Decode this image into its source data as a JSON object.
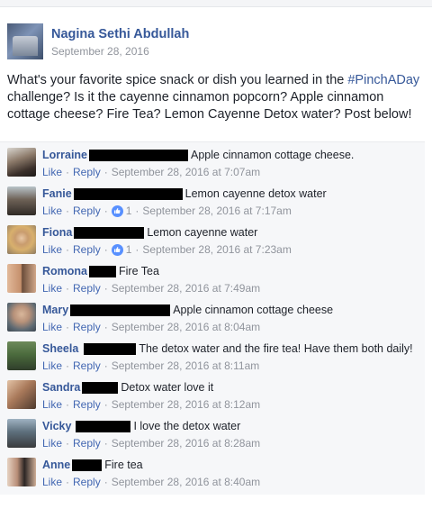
{
  "post": {
    "author": "Nagina Sethi Abdullah",
    "date": "September 28, 2016",
    "text_before": "What's your favorite spice snack or dish you learned in the ",
    "hashtag": "#PinchADay",
    "text_after": " challenge? Is it the cayenne cinnamon popcorn? Apple cinnamon cottage cheese? Fire Tea? Lemon Cayenne Detox water? Post below!"
  },
  "actions": {
    "like": "Like",
    "reply": "Reply",
    "dot": "·"
  },
  "colors": {
    "link": "#365899",
    "meta": "#90949c",
    "redaction": "#000000",
    "reaction": "#5890ff"
  },
  "comments": [
    {
      "name": "Lorraine",
      "text": "Apple cinnamon cottage cheese.",
      "timestamp": "September 28, 2016 at 7:07am",
      "reactions": null
    },
    {
      "name": "Fanie",
      "text": "Lemon cayenne detox water",
      "timestamp": "September 28, 2016 at 7:17am",
      "reactions": "1"
    },
    {
      "name": "Fiona",
      "text": "Lemon cayenne water",
      "timestamp": "September 28, 2016 at 7:23am",
      "reactions": "1"
    },
    {
      "name": "Romona",
      "text": "Fire Tea",
      "timestamp": "September 28, 2016 at 7:49am",
      "reactions": null
    },
    {
      "name": "Mary",
      "text": "Apple cinnamon cottage cheese",
      "timestamp": "September 28, 2016 at 8:04am",
      "reactions": null
    },
    {
      "name": "Sheela",
      "text": "The detox water and the fire tea! Have them both daily!",
      "timestamp": "September 28, 2016 at 8:11am",
      "reactions": null
    },
    {
      "name": "Sandra",
      "text": "Detox water love it",
      "timestamp": "September 28, 2016 at 8:12am",
      "reactions": null
    },
    {
      "name": "Vicky",
      "text": "I love the detox water",
      "timestamp": "September 28, 2016 at 8:28am",
      "reactions": null
    },
    {
      "name": "Anne",
      "text": "Fire tea",
      "timestamp": "September 28, 2016 at 8:40am",
      "reactions": null
    }
  ]
}
